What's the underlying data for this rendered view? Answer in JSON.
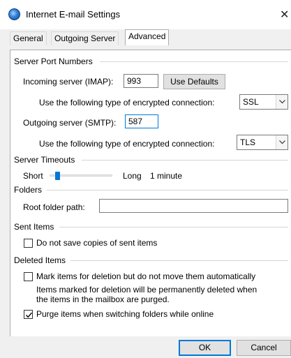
{
  "window": {
    "title": "Internet E-mail Settings",
    "close_glyph": "✕"
  },
  "tabs": [
    {
      "label": "General"
    },
    {
      "label": "Outgoing Server"
    },
    {
      "label": "Advanced"
    }
  ],
  "server_ports": {
    "heading": "Server Port Numbers",
    "incoming_label": "Incoming server (IMAP):",
    "incoming_value": "993",
    "use_defaults_label": "Use Defaults",
    "incoming_encryption_label": "Use the following type of encrypted connection:",
    "incoming_encryption_value": "SSL",
    "outgoing_label": "Outgoing server (SMTP):",
    "outgoing_value": "587",
    "outgoing_encryption_label": "Use the following type of encrypted connection:",
    "outgoing_encryption_value": "TLS"
  },
  "timeouts": {
    "heading": "Server Timeouts",
    "short_label": "Short",
    "long_label": "Long",
    "value_label": "1 minute",
    "slider_position": 0.12
  },
  "folders": {
    "heading": "Folders",
    "root_label": "Root folder path:",
    "root_value": ""
  },
  "sent_items": {
    "heading": "Sent Items",
    "no_save_label": "Do not save copies of sent items",
    "no_save_checked": false
  },
  "deleted_items": {
    "heading": "Deleted Items",
    "mark_label": "Mark items for deletion but do not move them automatically",
    "mark_checked": false,
    "info_line1": "Items marked for deletion will be permanently deleted when",
    "info_line2": "the items in the mailbox are purged.",
    "purge_label": "Purge items when switching folders while online",
    "purge_checked": true
  },
  "footer": {
    "ok_label": "OK",
    "cancel_label": "Cancel"
  },
  "colors": {
    "accent": "#0078d7",
    "dialog_bg": "#f0f0f0"
  }
}
